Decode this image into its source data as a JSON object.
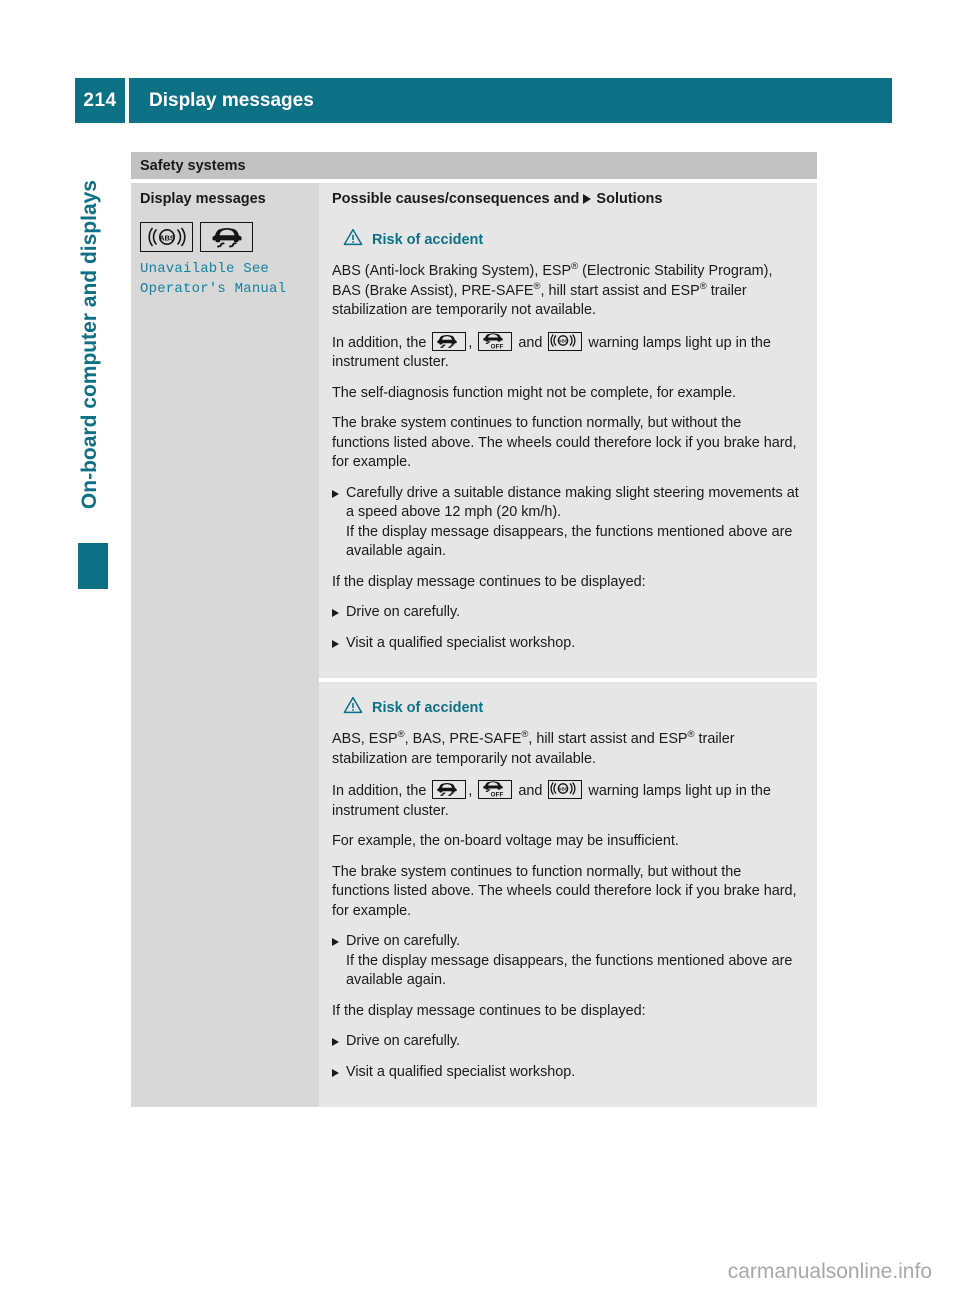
{
  "header": {
    "page_number": "214",
    "title": "Display messages"
  },
  "sidebar": {
    "chapter_label": "On-board computer and displays"
  },
  "table": {
    "section_title": "Safety systems",
    "column_headers": {
      "left": "Display messages",
      "right_pre": "Possible causes/consequences and",
      "right_post": "Solutions"
    },
    "left_cell": {
      "icons": [
        "abs-warning-icon",
        "esp-skid-warning-icon"
      ],
      "message_line1": "Unavailable See",
      "message_line2": "Operator's Manual"
    },
    "sections": [
      {
        "warning_title": "Risk of accident",
        "blocks": [
          {
            "type": "paragraph",
            "runs": [
              {
                "t": "ABS (Anti-lock Braking System), ESP"
              },
              {
                "t": "®",
                "sup": true
              },
              {
                "t": " (Electronic Stability Program), BAS (Brake Assist), PRE-SAFE"
              },
              {
                "t": "®",
                "sup": true
              },
              {
                "t": ", hill start assist and ESP"
              },
              {
                "t": "®",
                "sup": true
              },
              {
                "t": " trailer stabilization are temporarily not available."
              }
            ]
          },
          {
            "type": "paragraph-icons",
            "pre": "In addition, the",
            "mid": ",",
            "and": "and",
            "post": "warning lamps light up in the instrument cluster.",
            "icons": [
              "esp-skid-warning-icon",
              "esp-off-warning-icon",
              "abs-warning-icon"
            ]
          },
          {
            "type": "paragraph",
            "text": "The self-diagnosis function might not be complete, for example."
          },
          {
            "type": "paragraph",
            "text": "The brake system continues to function normally, but without the functions listed above. The wheels could therefore lock if you brake hard, for example."
          },
          {
            "type": "bullet",
            "text": "Carefully drive a suitable distance making slight steering movements at a speed above 12 mph (20 km/h).",
            "sub": "If the display message disappears, the functions mentioned above are available again."
          },
          {
            "type": "paragraph",
            "text": "If the display message continues to be displayed:"
          },
          {
            "type": "bullet",
            "text": "Drive on carefully."
          },
          {
            "type": "bullet",
            "text": "Visit a qualified specialist workshop."
          }
        ]
      },
      {
        "warning_title": "Risk of accident",
        "blocks": [
          {
            "type": "paragraph",
            "runs": [
              {
                "t": "ABS, ESP"
              },
              {
                "t": "®",
                "sup": true
              },
              {
                "t": ", BAS, PRE-SAFE"
              },
              {
                "t": "®",
                "sup": true
              },
              {
                "t": ", hill start assist and ESP"
              },
              {
                "t": "®",
                "sup": true
              },
              {
                "t": " trailer stabilization are temporarily not available."
              }
            ]
          },
          {
            "type": "paragraph-icons",
            "pre": "In addition, the",
            "mid": ",",
            "and": "and",
            "post": "warning lamps light up in the instrument cluster.",
            "icons": [
              "esp-skid-warning-icon",
              "esp-off-warning-icon",
              "abs-warning-icon"
            ]
          },
          {
            "type": "paragraph",
            "text": "For example, the on-board voltage may be insufficient."
          },
          {
            "type": "paragraph",
            "text": "The brake system continues to function normally, but without the functions listed above. The wheels could therefore lock if you brake hard, for example."
          },
          {
            "type": "bullet",
            "text": "Drive on carefully.",
            "sub": "If the display message disappears, the functions mentioned above are available again."
          },
          {
            "type": "paragraph",
            "text": "If the display message continues to be displayed:"
          },
          {
            "type": "bullet",
            "text": "Drive on carefully."
          },
          {
            "type": "bullet",
            "text": "Visit a qualified specialist workshop."
          }
        ]
      }
    ]
  },
  "footer": {
    "watermark": "carmanualsonline.info"
  },
  "colors": {
    "teal": "#0d7186",
    "message_teal": "#1283a0",
    "section_gray": "#c2c2c2",
    "left_col_gray": "#d8d8d8",
    "right_col_gray": "#e6e6e6"
  }
}
